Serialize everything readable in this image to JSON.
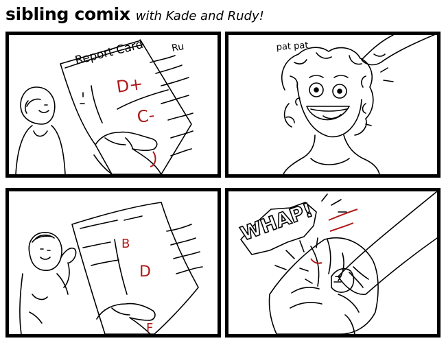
{
  "header": {
    "title": "sibling comix",
    "subtitle": "with Kade and Rudy!"
  },
  "panels": {
    "p1": {
      "paper_heading": "Report Card",
      "scribble": "Ru",
      "grades": [
        "D+",
        "C-"
      ]
    },
    "p2": {
      "sound_effect": "pat pat"
    },
    "p3": {
      "grades": [
        "B",
        "D",
        "F"
      ]
    },
    "p4": {
      "sound_effect": "WHAP!"
    }
  },
  "colors": {
    "ink": "#000000",
    "grade_red": "#b01818",
    "paper": "#ffffff"
  }
}
